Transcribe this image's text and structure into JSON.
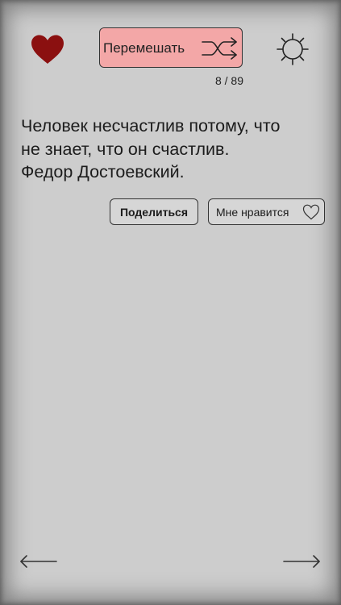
{
  "toolbar": {
    "favorites_icon": "heart-filled-icon",
    "shuffle_label": "Перемешать",
    "shuffle_icon": "shuffle-icon",
    "settings_icon": "sun-gear-icon",
    "counter": "8 / 89"
  },
  "quote": {
    "lines": [
      "Человек несчастлив потому, что",
      "не знает, что он счастлив.",
      "Федор Достоевский."
    ]
  },
  "actions": {
    "share_label": "Поделиться",
    "like_label": "Мне нравится",
    "like_icon": "heart-outline-icon"
  },
  "navigation": {
    "prev_icon": "arrow-left-icon",
    "next_icon": "arrow-right-icon"
  },
  "colors": {
    "background": "#cdcdcd",
    "shuffle_button": "#f3a7a7",
    "heart": "#8b1010"
  }
}
